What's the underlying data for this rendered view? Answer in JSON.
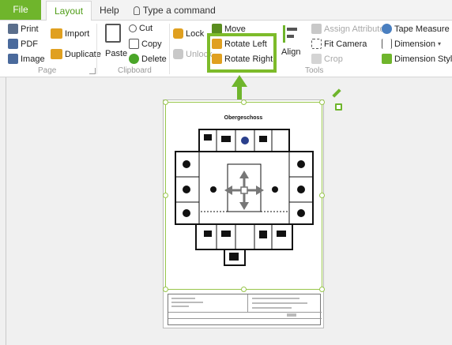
{
  "tabs": {
    "file": "File",
    "layout": "Layout",
    "help": "Help",
    "command_placeholder": "Type a command"
  },
  "ribbon": {
    "page": {
      "print": "Print",
      "pdf": "PDF",
      "image": "Image",
      "import": "Import",
      "duplicate": "Duplicate",
      "label": "Page"
    },
    "clipboard": {
      "paste": "Paste",
      "cut": "Cut",
      "copy": "Copy",
      "delete": "Delete",
      "label": "Clipboard"
    },
    "lock": {
      "lock": "Lock",
      "unlock": "Unlock"
    },
    "move": {
      "move": "Move",
      "rotate_left": "Rotate Left",
      "rotate_right": "Rotate Right"
    },
    "align": {
      "label": "Align"
    },
    "tools": {
      "assign_attributes": "Assign Attributes",
      "fit_camera": "Fit Camera",
      "crop": "Crop",
      "tape_measure": "Tape Measure",
      "dimension": "Dimension",
      "dimension_styles": "Dimension Styles",
      "label": "Tools"
    }
  },
  "canvas": {
    "plan_title": "Obergeschoss"
  },
  "colors": {
    "accent": "#6fb52c",
    "highlight": "#7dbb2a",
    "selection": "#98c64b"
  }
}
